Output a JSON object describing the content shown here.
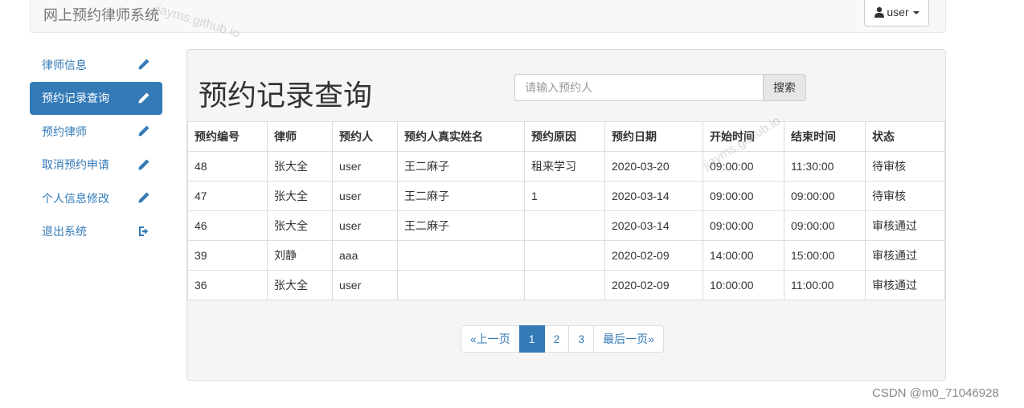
{
  "navbar": {
    "brand": "网上预约律师系统",
    "user_label": "user"
  },
  "sidebar": {
    "items": [
      {
        "label": "律师信息",
        "icon": "pencil-icon"
      },
      {
        "label": "预约记录查询",
        "icon": "pencil-icon",
        "active": true
      },
      {
        "label": "预约律师",
        "icon": "pencil-icon"
      },
      {
        "label": "取消预约申请",
        "icon": "pencil-icon"
      },
      {
        "label": "个人信息修改",
        "icon": "pencil-icon"
      },
      {
        "label": "退出系统",
        "icon": "logout-icon"
      }
    ]
  },
  "main": {
    "title": "预约记录查询",
    "search": {
      "placeholder": "请输入预约人",
      "value": "",
      "button_label": "搜索"
    },
    "table": {
      "headers": [
        "预约编号",
        "律师",
        "预约人",
        "预约人真实姓名",
        "预约原因",
        "预约日期",
        "开始时间",
        "结束时间",
        "状态"
      ],
      "rows": [
        [
          "48",
          "张大全",
          "user",
          "王二麻子",
          "租来学习",
          "2020-03-20",
          "09:00:00",
          "11:30:00",
          "待审核"
        ],
        [
          "47",
          "张大全",
          "user",
          "王二麻子",
          "1",
          "2020-03-14",
          "09:00:00",
          "09:00:00",
          "待审核"
        ],
        [
          "46",
          "张大全",
          "user",
          "王二麻子",
          "",
          "2020-03-14",
          "09:00:00",
          "09:00:00",
          "审核通过"
        ],
        [
          "39",
          "刘静",
          "aaa",
          "",
          "",
          "2020-02-09",
          "14:00:00",
          "15:00:00",
          "审核通过"
        ],
        [
          "36",
          "张大全",
          "user",
          "",
          "",
          "2020-02-09",
          "10:00:00",
          "11:00:00",
          "审核通过"
        ]
      ]
    },
    "pagination": {
      "prev": "«上一页",
      "pages": [
        "1",
        "2",
        "3"
      ],
      "current": "1",
      "last": "最后一页»"
    }
  },
  "footer_watermark": "CSDN @m0_71046928",
  "overlay_watermark": "jiayms.github.io",
  "colors": {
    "accent": "#337ab7",
    "panel_bg": "#f5f5f5"
  }
}
